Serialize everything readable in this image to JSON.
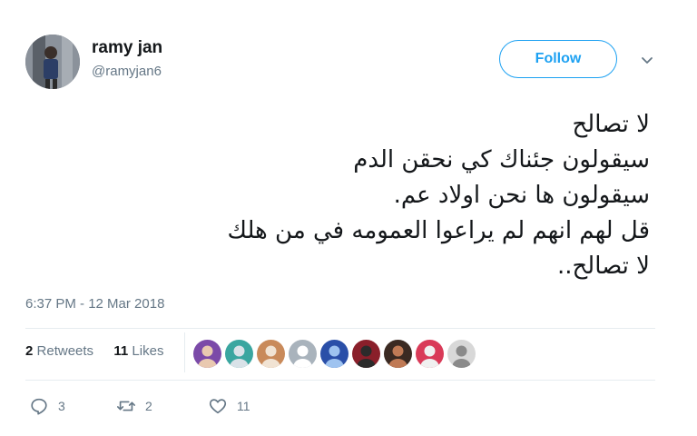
{
  "tweet": {
    "author": {
      "name": "ramy jan",
      "handle": "@ramyjan6"
    },
    "follow_label": "Follow",
    "text_lines": [
      "لا تصالح",
      "سيقولون جئناك كي نحقن الدم",
      "سيقولون ها نحن اولاد عم.",
      "قل لهم انهم لم يراعوا العمومه في من هلك",
      "لا تصالح.."
    ],
    "timestamp": "6:37 PM - 12 Mar 2018",
    "stats": {
      "retweets_count": "2",
      "retweets_label": "Retweets",
      "likes_count": "11",
      "likes_label": "Likes"
    },
    "liker_avatars": [
      {
        "colors": [
          "#7b4aa8",
          "#e9c9b0"
        ]
      },
      {
        "colors": [
          "#3aa6a0",
          "#d9e2e8"
        ]
      },
      {
        "colors": [
          "#c98a5a",
          "#f1e3d3"
        ]
      },
      {
        "colors": [
          "#a9b3bc",
          "#ffffff"
        ]
      },
      {
        "colors": [
          "#2a4fa8",
          "#9ec3f0"
        ]
      },
      {
        "colors": [
          "#8a1f2a",
          "#2b2b2b"
        ]
      },
      {
        "colors": [
          "#3b2a22",
          "#c07a55"
        ]
      },
      {
        "colors": [
          "#d93a58",
          "#f0f0f0"
        ]
      },
      {
        "colors": [
          "#d8d8d8",
          "#8a8a8a"
        ]
      }
    ],
    "actions": {
      "reply_count": "3",
      "retweet_count": "2",
      "like_count": "11"
    },
    "colors": {
      "accent": "#1da1f2",
      "secondary_text": "#657786",
      "divider": "#e6ecf0"
    },
    "icons": {
      "more": "chevron-down-icon",
      "reply": "reply-icon",
      "retweet": "retweet-icon",
      "like": "heart-icon"
    }
  }
}
